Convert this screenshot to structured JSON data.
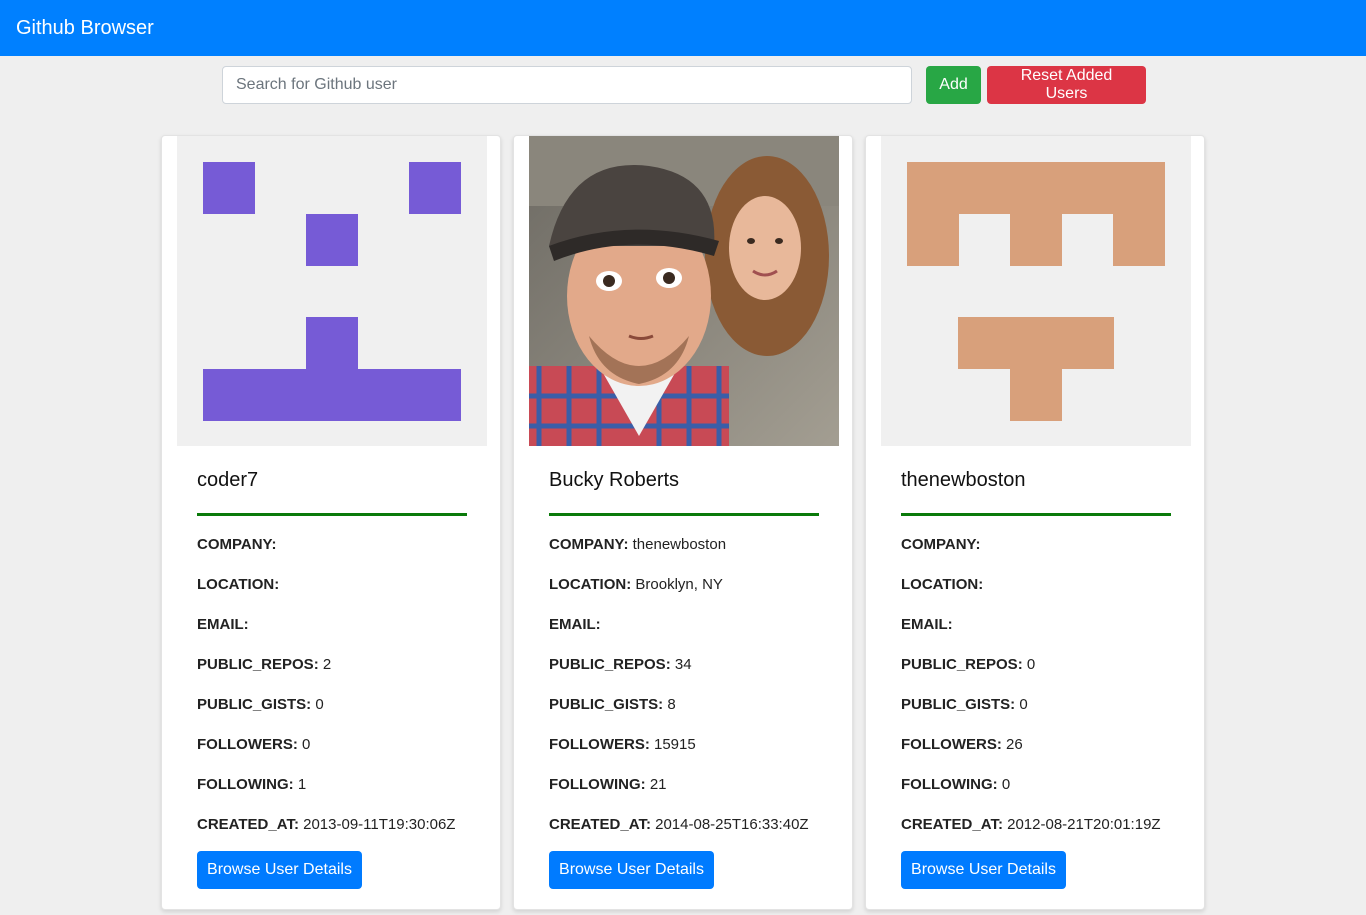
{
  "app": {
    "title": "Github Browser"
  },
  "search": {
    "placeholder": "Search for Github user",
    "value": ""
  },
  "buttons": {
    "add": "Add",
    "reset": "Reset Added Users"
  },
  "labels": {
    "company": "COMPANY:",
    "location": "LOCATION:",
    "email": "EMAIL:",
    "public_repos": "PUBLIC_REPOS:",
    "public_gists": "PUBLIC_GISTS:",
    "followers": "FOLLOWERS:",
    "following": "FOLLOWING:",
    "created_at": "CREATED_AT:"
  },
  "colors": {
    "navbar": "#0080ff",
    "add": "#28a745",
    "reset": "#dc3545",
    "primary": "#007bff",
    "divider": "#0a7a0a"
  },
  "users": [
    {
      "name": "coder7",
      "avatar": "identicon-purple",
      "company": "",
      "location": "",
      "email": "",
      "public_repos": "2",
      "public_gists": "0",
      "followers": "0",
      "following": "1",
      "created_at": "2013-09-11T19:30:06Z",
      "button": "Browse User Details"
    },
    {
      "name": "Bucky Roberts",
      "avatar": "photo-selfie",
      "company": "thenewboston",
      "location": "Brooklyn, NY",
      "email": "",
      "public_repos": "34",
      "public_gists": "8",
      "followers": "15915",
      "following": "21",
      "created_at": "2014-08-25T16:33:40Z",
      "button": "Browse User Details"
    },
    {
      "name": "thenewboston",
      "avatar": "identicon-tan",
      "company": "",
      "location": "",
      "email": "",
      "public_repos": "0",
      "public_gists": "0",
      "followers": "26",
      "following": "0",
      "created_at": "2012-08-21T20:01:19Z",
      "button": "Browse User Details"
    }
  ]
}
